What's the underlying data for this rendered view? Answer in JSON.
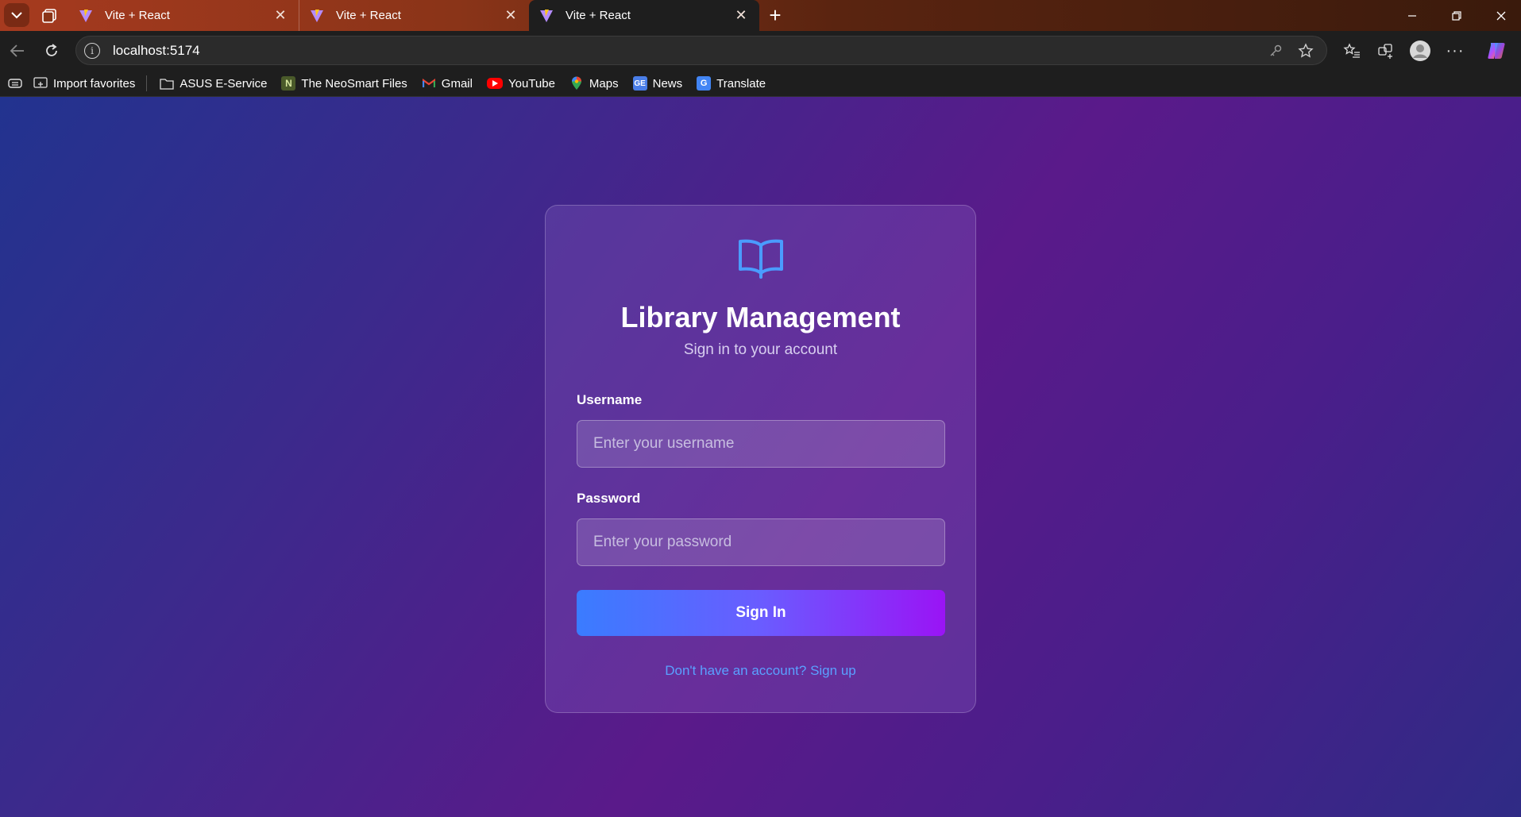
{
  "browser": {
    "tabs": [
      {
        "title": "Vite + React",
        "active": false
      },
      {
        "title": "Vite + React",
        "active": false
      },
      {
        "title": "Vite + React",
        "active": true
      }
    ],
    "address": "localhost:5174",
    "bookmarks": [
      {
        "label": "Import favorites",
        "icon": "import-icon"
      },
      {
        "label": "ASUS E-Service",
        "icon": "folder-icon"
      },
      {
        "label": "The NeoSmart Files",
        "icon": "neosmart-icon"
      },
      {
        "label": "Gmail",
        "icon": "gmail-icon"
      },
      {
        "label": "YouTube",
        "icon": "youtube-icon"
      },
      {
        "label": "Maps",
        "icon": "maps-icon"
      },
      {
        "label": "News",
        "icon": "news-icon"
      },
      {
        "label": "Translate",
        "icon": "translate-icon"
      }
    ]
  },
  "login": {
    "title": "Library Management",
    "subtitle": "Sign in to your account",
    "username_label": "Username",
    "username_placeholder": "Enter your username",
    "password_label": "Password",
    "password_placeholder": "Enter your password",
    "submit_label": "Sign In",
    "signup_text": "Don't have an account? Sign up"
  },
  "colors": {
    "accent_blue": "#3a7cff",
    "accent_purple": "#9a14f5",
    "link": "#5aa0ff",
    "icon_blue": "#4a9cff"
  }
}
